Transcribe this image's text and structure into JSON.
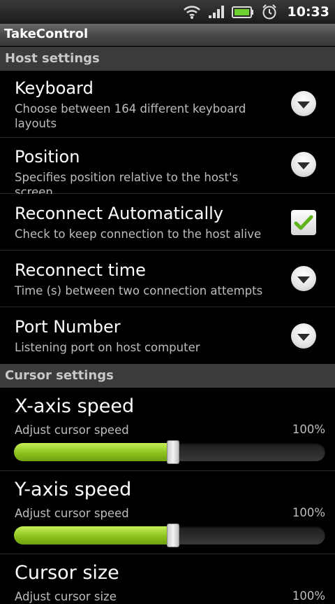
{
  "status_bar": {
    "time": "10:33",
    "icons": [
      "wifi-icon",
      "signal-icon",
      "battery-icon",
      "alarm-clock-icon"
    ]
  },
  "app": {
    "title": "TakeControl"
  },
  "sections": {
    "host": {
      "header": "Host settings",
      "items": [
        {
          "title": "Keyboard",
          "summary": "Choose between 164 different keyboard layouts",
          "widget": "dropdown"
        },
        {
          "title": "Position",
          "summary": "Specifies position relative to the host's screen",
          "widget": "dropdown"
        },
        {
          "title": "Reconnect Automatically",
          "summary": "Check to keep connection to the host alive",
          "widget": "checkbox",
          "checked": true
        },
        {
          "title": "Reconnect time",
          "summary": "Time (s) between two connection attempts",
          "widget": "dropdown"
        },
        {
          "title": "Port Number",
          "summary": "Listening port on host computer",
          "widget": "dropdown"
        }
      ]
    },
    "cursor": {
      "header": "Cursor settings",
      "items": [
        {
          "title": "X-axis speed",
          "summary": "Adjust cursor speed",
          "value": "100%",
          "slider_level": 0.5
        },
        {
          "title": "Y-axis speed",
          "summary": "Adjust cursor speed",
          "value": "100%",
          "slider_level": 0.5
        },
        {
          "title": "Cursor size",
          "summary": "Adjust cursor size",
          "value": "100%"
        }
      ]
    }
  },
  "colors": {
    "accent_green": "#8cc21e",
    "check_green": "#5fb31c",
    "section_header_bg": "#3b3b3b"
  }
}
